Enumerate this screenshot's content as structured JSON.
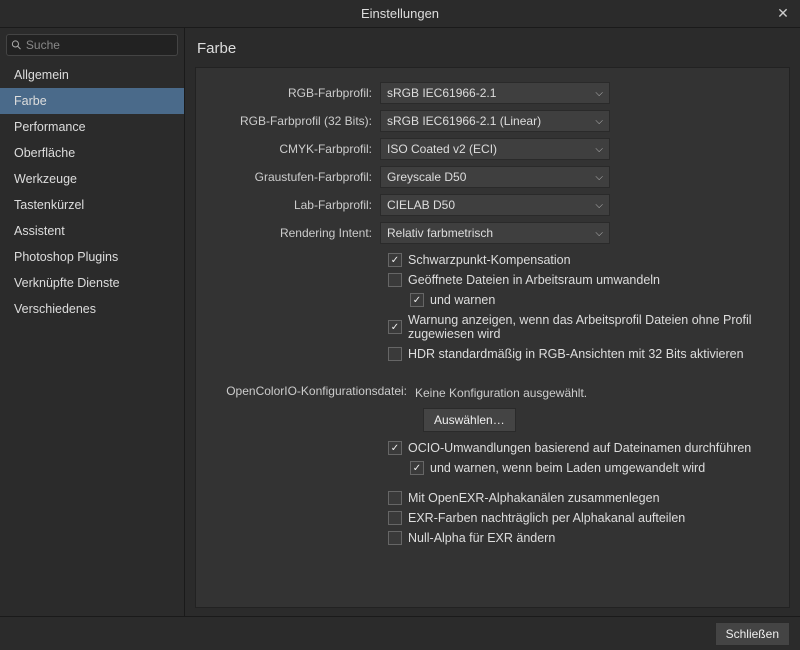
{
  "window": {
    "title": "Einstellungen"
  },
  "search": {
    "placeholder": "Suche"
  },
  "sidebar": {
    "items": [
      {
        "label": "Allgemein"
      },
      {
        "label": "Farbe"
      },
      {
        "label": "Performance"
      },
      {
        "label": "Oberfläche"
      },
      {
        "label": "Werkzeuge"
      },
      {
        "label": "Tastenkürzel"
      },
      {
        "label": "Assistent"
      },
      {
        "label": "Photoshop Plugins"
      },
      {
        "label": "Verknüpfte Dienste"
      },
      {
        "label": "Verschiedenes"
      }
    ],
    "selected_index": 1
  },
  "page": {
    "title": "Farbe"
  },
  "profiles": {
    "rgb": {
      "label": "RGB-Farbprofil:",
      "value": "sRGB IEC61966-2.1"
    },
    "rgb32": {
      "label": "RGB-Farbprofil (32 Bits):",
      "value": "sRGB IEC61966-2.1 (Linear)"
    },
    "cmyk": {
      "label": "CMYK-Farbprofil:",
      "value": "ISO Coated v2 (ECI)"
    },
    "grayscale": {
      "label": "Graustufen-Farbprofil:",
      "value": "Greyscale D50"
    },
    "lab": {
      "label": "Lab-Farbprofil:",
      "value": "CIELAB D50"
    },
    "intent": {
      "label": "Rendering Intent:",
      "value": "Relativ farbmetrisch"
    }
  },
  "options": {
    "black_point": {
      "label": "Schwarzpunkt-Kompensation",
      "checked": true
    },
    "convert_opened": {
      "label": "Geöffnete Dateien in Arbeitsraum umwandeln",
      "checked": false
    },
    "convert_warn": {
      "label": "und warnen",
      "checked": true
    },
    "warn_profile": {
      "label": "Warnung anzeigen, wenn das Arbeitsprofil Dateien ohne Profil zugewiesen wird",
      "checked": true
    },
    "hdr_default": {
      "label": "HDR standardmäßig in RGB-Ansichten mit 32 Bits aktivieren",
      "checked": false
    }
  },
  "ocio": {
    "label": "OpenColorIO-Konfigurationsdatei:",
    "status": "Keine Konfiguration ausgewählt.",
    "choose_button": "Auswählen…",
    "filename": {
      "label": "OCIO-Umwandlungen basierend auf Dateinamen durchführen",
      "checked": true
    },
    "filename_warn": {
      "label": "und warnen, wenn beim Laden umgewandelt wird",
      "checked": true
    }
  },
  "exr": {
    "merge_alpha": {
      "label": "Mit OpenEXR-Alphakanälen zusammenlegen",
      "checked": false
    },
    "split_alpha": {
      "label": "EXR-Farben nachträglich per Alphakanal aufteilen",
      "checked": false
    },
    "null_alpha": {
      "label": "Null-Alpha für EXR ändern",
      "checked": false
    }
  },
  "footer": {
    "close": "Schließen"
  }
}
